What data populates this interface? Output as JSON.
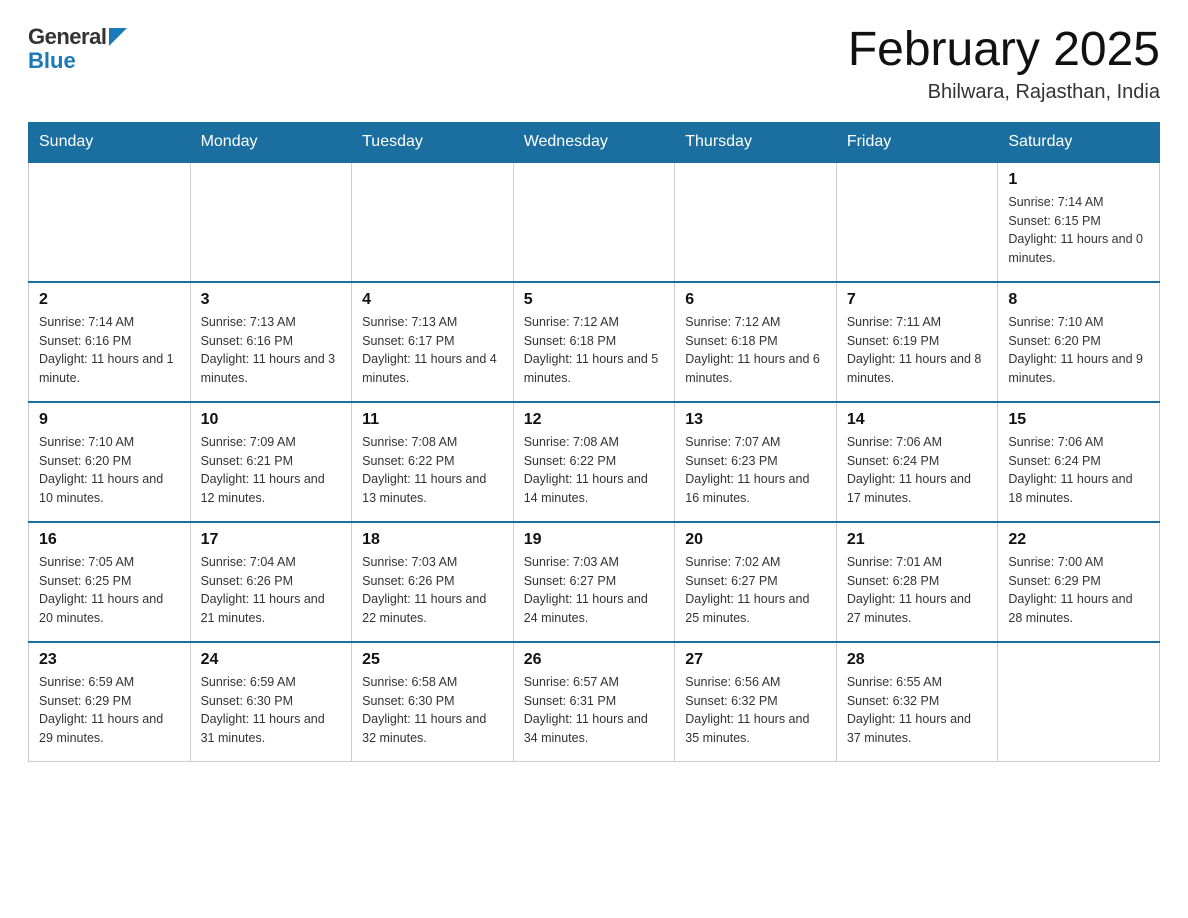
{
  "header": {
    "logo": {
      "general": "General",
      "blue": "Blue"
    },
    "title": "February 2025",
    "location": "Bhilwara, Rajasthan, India"
  },
  "days_of_week": [
    "Sunday",
    "Monday",
    "Tuesday",
    "Wednesday",
    "Thursday",
    "Friday",
    "Saturday"
  ],
  "weeks": [
    [
      {
        "day": "",
        "sunrise": "",
        "sunset": "",
        "daylight": ""
      },
      {
        "day": "",
        "sunrise": "",
        "sunset": "",
        "daylight": ""
      },
      {
        "day": "",
        "sunrise": "",
        "sunset": "",
        "daylight": ""
      },
      {
        "day": "",
        "sunrise": "",
        "sunset": "",
        "daylight": ""
      },
      {
        "day": "",
        "sunrise": "",
        "sunset": "",
        "daylight": ""
      },
      {
        "day": "",
        "sunrise": "",
        "sunset": "",
        "daylight": ""
      },
      {
        "day": "1",
        "sunrise": "Sunrise: 7:14 AM",
        "sunset": "Sunset: 6:15 PM",
        "daylight": "Daylight: 11 hours and 0 minutes."
      }
    ],
    [
      {
        "day": "2",
        "sunrise": "Sunrise: 7:14 AM",
        "sunset": "Sunset: 6:16 PM",
        "daylight": "Daylight: 11 hours and 1 minute."
      },
      {
        "day": "3",
        "sunrise": "Sunrise: 7:13 AM",
        "sunset": "Sunset: 6:16 PM",
        "daylight": "Daylight: 11 hours and 3 minutes."
      },
      {
        "day": "4",
        "sunrise": "Sunrise: 7:13 AM",
        "sunset": "Sunset: 6:17 PM",
        "daylight": "Daylight: 11 hours and 4 minutes."
      },
      {
        "day": "5",
        "sunrise": "Sunrise: 7:12 AM",
        "sunset": "Sunset: 6:18 PM",
        "daylight": "Daylight: 11 hours and 5 minutes."
      },
      {
        "day": "6",
        "sunrise": "Sunrise: 7:12 AM",
        "sunset": "Sunset: 6:18 PM",
        "daylight": "Daylight: 11 hours and 6 minutes."
      },
      {
        "day": "7",
        "sunrise": "Sunrise: 7:11 AM",
        "sunset": "Sunset: 6:19 PM",
        "daylight": "Daylight: 11 hours and 8 minutes."
      },
      {
        "day": "8",
        "sunrise": "Sunrise: 7:10 AM",
        "sunset": "Sunset: 6:20 PM",
        "daylight": "Daylight: 11 hours and 9 minutes."
      }
    ],
    [
      {
        "day": "9",
        "sunrise": "Sunrise: 7:10 AM",
        "sunset": "Sunset: 6:20 PM",
        "daylight": "Daylight: 11 hours and 10 minutes."
      },
      {
        "day": "10",
        "sunrise": "Sunrise: 7:09 AM",
        "sunset": "Sunset: 6:21 PM",
        "daylight": "Daylight: 11 hours and 12 minutes."
      },
      {
        "day": "11",
        "sunrise": "Sunrise: 7:08 AM",
        "sunset": "Sunset: 6:22 PM",
        "daylight": "Daylight: 11 hours and 13 minutes."
      },
      {
        "day": "12",
        "sunrise": "Sunrise: 7:08 AM",
        "sunset": "Sunset: 6:22 PM",
        "daylight": "Daylight: 11 hours and 14 minutes."
      },
      {
        "day": "13",
        "sunrise": "Sunrise: 7:07 AM",
        "sunset": "Sunset: 6:23 PM",
        "daylight": "Daylight: 11 hours and 16 minutes."
      },
      {
        "day": "14",
        "sunrise": "Sunrise: 7:06 AM",
        "sunset": "Sunset: 6:24 PM",
        "daylight": "Daylight: 11 hours and 17 minutes."
      },
      {
        "day": "15",
        "sunrise": "Sunrise: 7:06 AM",
        "sunset": "Sunset: 6:24 PM",
        "daylight": "Daylight: 11 hours and 18 minutes."
      }
    ],
    [
      {
        "day": "16",
        "sunrise": "Sunrise: 7:05 AM",
        "sunset": "Sunset: 6:25 PM",
        "daylight": "Daylight: 11 hours and 20 minutes."
      },
      {
        "day": "17",
        "sunrise": "Sunrise: 7:04 AM",
        "sunset": "Sunset: 6:26 PM",
        "daylight": "Daylight: 11 hours and 21 minutes."
      },
      {
        "day": "18",
        "sunrise": "Sunrise: 7:03 AM",
        "sunset": "Sunset: 6:26 PM",
        "daylight": "Daylight: 11 hours and 22 minutes."
      },
      {
        "day": "19",
        "sunrise": "Sunrise: 7:03 AM",
        "sunset": "Sunset: 6:27 PM",
        "daylight": "Daylight: 11 hours and 24 minutes."
      },
      {
        "day": "20",
        "sunrise": "Sunrise: 7:02 AM",
        "sunset": "Sunset: 6:27 PM",
        "daylight": "Daylight: 11 hours and 25 minutes."
      },
      {
        "day": "21",
        "sunrise": "Sunrise: 7:01 AM",
        "sunset": "Sunset: 6:28 PM",
        "daylight": "Daylight: 11 hours and 27 minutes."
      },
      {
        "day": "22",
        "sunrise": "Sunrise: 7:00 AM",
        "sunset": "Sunset: 6:29 PM",
        "daylight": "Daylight: 11 hours and 28 minutes."
      }
    ],
    [
      {
        "day": "23",
        "sunrise": "Sunrise: 6:59 AM",
        "sunset": "Sunset: 6:29 PM",
        "daylight": "Daylight: 11 hours and 29 minutes."
      },
      {
        "day": "24",
        "sunrise": "Sunrise: 6:59 AM",
        "sunset": "Sunset: 6:30 PM",
        "daylight": "Daylight: 11 hours and 31 minutes."
      },
      {
        "day": "25",
        "sunrise": "Sunrise: 6:58 AM",
        "sunset": "Sunset: 6:30 PM",
        "daylight": "Daylight: 11 hours and 32 minutes."
      },
      {
        "day": "26",
        "sunrise": "Sunrise: 6:57 AM",
        "sunset": "Sunset: 6:31 PM",
        "daylight": "Daylight: 11 hours and 34 minutes."
      },
      {
        "day": "27",
        "sunrise": "Sunrise: 6:56 AM",
        "sunset": "Sunset: 6:32 PM",
        "daylight": "Daylight: 11 hours and 35 minutes."
      },
      {
        "day": "28",
        "sunrise": "Sunrise: 6:55 AM",
        "sunset": "Sunset: 6:32 PM",
        "daylight": "Daylight: 11 hours and 37 minutes."
      },
      {
        "day": "",
        "sunrise": "",
        "sunset": "",
        "daylight": ""
      }
    ]
  ]
}
